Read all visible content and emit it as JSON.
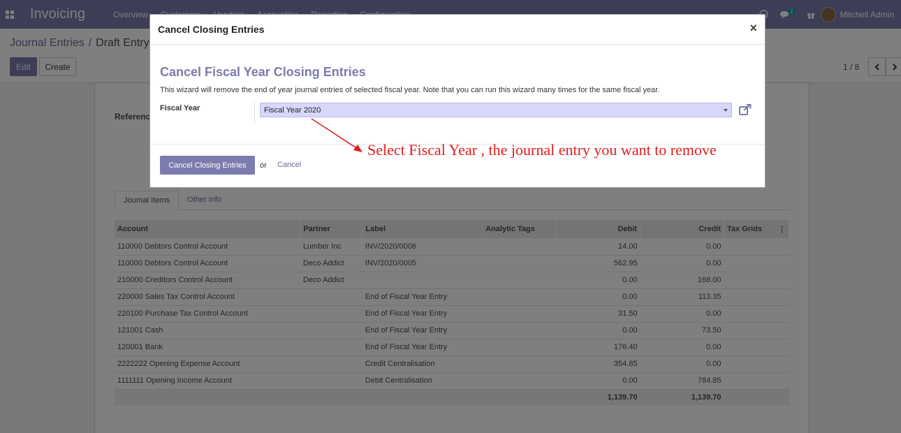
{
  "navbar": {
    "app_name": "Invoicing",
    "menu": [
      "Overview",
      "Customers",
      "Vendors",
      "Accounting",
      "Reporting",
      "Configuration"
    ],
    "message_count": "2",
    "user_name": "Mitchell Admin"
  },
  "control_panel": {
    "breadcrumb": [
      "Journal Entries",
      "Draft Entry"
    ],
    "breadcrumb_sep": "/",
    "edit_label": "Edit",
    "create_label": "Create",
    "pager": "1 / 8"
  },
  "form": {
    "reference_label": "Reference",
    "tabs": [
      "Journal Items",
      "Other Info"
    ]
  },
  "table": {
    "headers": {
      "account": "Account",
      "partner": "Partner",
      "label": "Label",
      "analytic_tags": "Analytic Tags",
      "debit": "Debit",
      "credit": "Credit",
      "tax_grids": "Tax Grids"
    },
    "rows": [
      {
        "account": "110000 Debtors Control Account",
        "partner": "Lumber Inc",
        "label": "INV/2020/0006",
        "debit": "14.00",
        "credit": "0.00"
      },
      {
        "account": "110000 Debtors Control Account",
        "partner": "Deco Addict",
        "label": "INV/2020/0005",
        "debit": "562.95",
        "credit": "0.00"
      },
      {
        "account": "210000 Creditors Control Account",
        "partner": "Deco Addict",
        "label": "",
        "debit": "0.00",
        "credit": "168.00"
      },
      {
        "account": "220000 Sales Tax Control Account",
        "partner": "",
        "label": "End of Fiscal Year Entry",
        "debit": "0.00",
        "credit": "113.35"
      },
      {
        "account": "220100 Purchase Tax Control Account",
        "partner": "",
        "label": "End of Fiscal Year Entry",
        "debit": "31.50",
        "credit": "0.00"
      },
      {
        "account": "121001 Cash",
        "partner": "",
        "label": "End of Fiscal Year Entry",
        "debit": "0.00",
        "credit": "73.50"
      },
      {
        "account": "120001 Bank",
        "partner": "",
        "label": "End of Fiscal Year Entry",
        "debit": "176.40",
        "credit": "0.00"
      },
      {
        "account": "2222222 Opening Expense Account",
        "partner": "",
        "label": "Credit Centralisation",
        "debit": "354.85",
        "credit": "0.00"
      },
      {
        "account": "1111111 Opening Income Account",
        "partner": "",
        "label": "Debit Centralisation",
        "debit": "0.00",
        "credit": "784.85"
      }
    ],
    "totals": {
      "debit": "1,139.70",
      "credit": "1,139.70"
    }
  },
  "modal": {
    "title": "Cancel Closing Entries",
    "close": "×",
    "wizard_title": "Cancel Fiscal Year Closing Entries",
    "description": "This wizard will remove the end of year journal entries of selected fiscal year. Note that you can run this wizard many times for the same fiscal year.",
    "fiscal_year_label": "Fiscal Year",
    "fiscal_year_value": "Fiscal Year 2020",
    "confirm_label": "Cancel Closing Entries",
    "or_text": "or",
    "cancel_label": "Cancel"
  },
  "annotation": {
    "text": "Select Fiscal Year , the journal entry you want to remove",
    "color": "#e31c1c"
  },
  "colors": {
    "brand": "#7c7bad",
    "selection": "#d7d7fb"
  }
}
